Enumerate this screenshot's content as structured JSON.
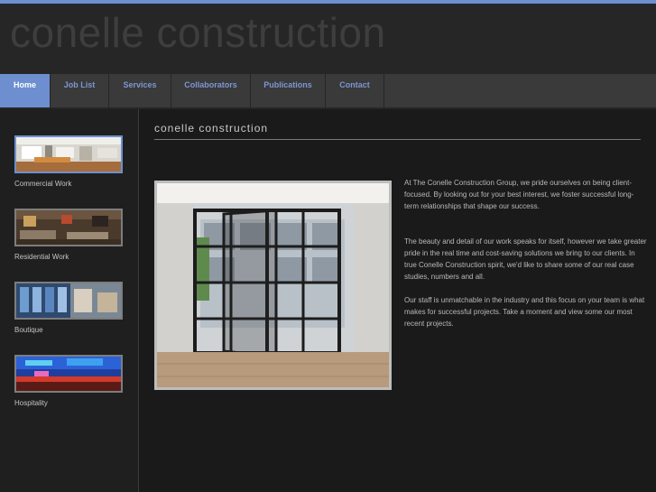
{
  "header": {
    "logo_text": "conelle construction"
  },
  "nav": {
    "items": [
      {
        "label": "Home",
        "active": true
      },
      {
        "label": "Job List"
      },
      {
        "label": "Services"
      },
      {
        "label": "Collaborators"
      },
      {
        "label": "Publications"
      },
      {
        "label": "Contact"
      }
    ]
  },
  "sidebar": {
    "items": [
      {
        "label": "Commercial Work"
      },
      {
        "label": "Residential Work"
      },
      {
        "label": "Boutique"
      },
      {
        "label": "Hospitality"
      }
    ]
  },
  "main": {
    "title": "conelle construction",
    "paragraphs": [
      "At The Conelle Construction Group, we pride ourselves on being client-focused. By looking out for your best interest, we foster successful long-term relationships that shape our success.",
      "The beauty and detail of our work speaks for itself, however we take greater pride in the real time and cost-saving solutions we bring to our clients. In true Conelle Construction spirit, we'd like to share some of our real case studies, numbers and all.",
      "Our staff is unmatchable in the industry and this focus on your team is what makes for successful projects. Take a moment and view some our most recent projects."
    ]
  },
  "colors": {
    "accent": "#6d8fd0",
    "nav_text": "#7d96d2",
    "background": "#1a1a1a",
    "logo": "#3e3e3e"
  }
}
